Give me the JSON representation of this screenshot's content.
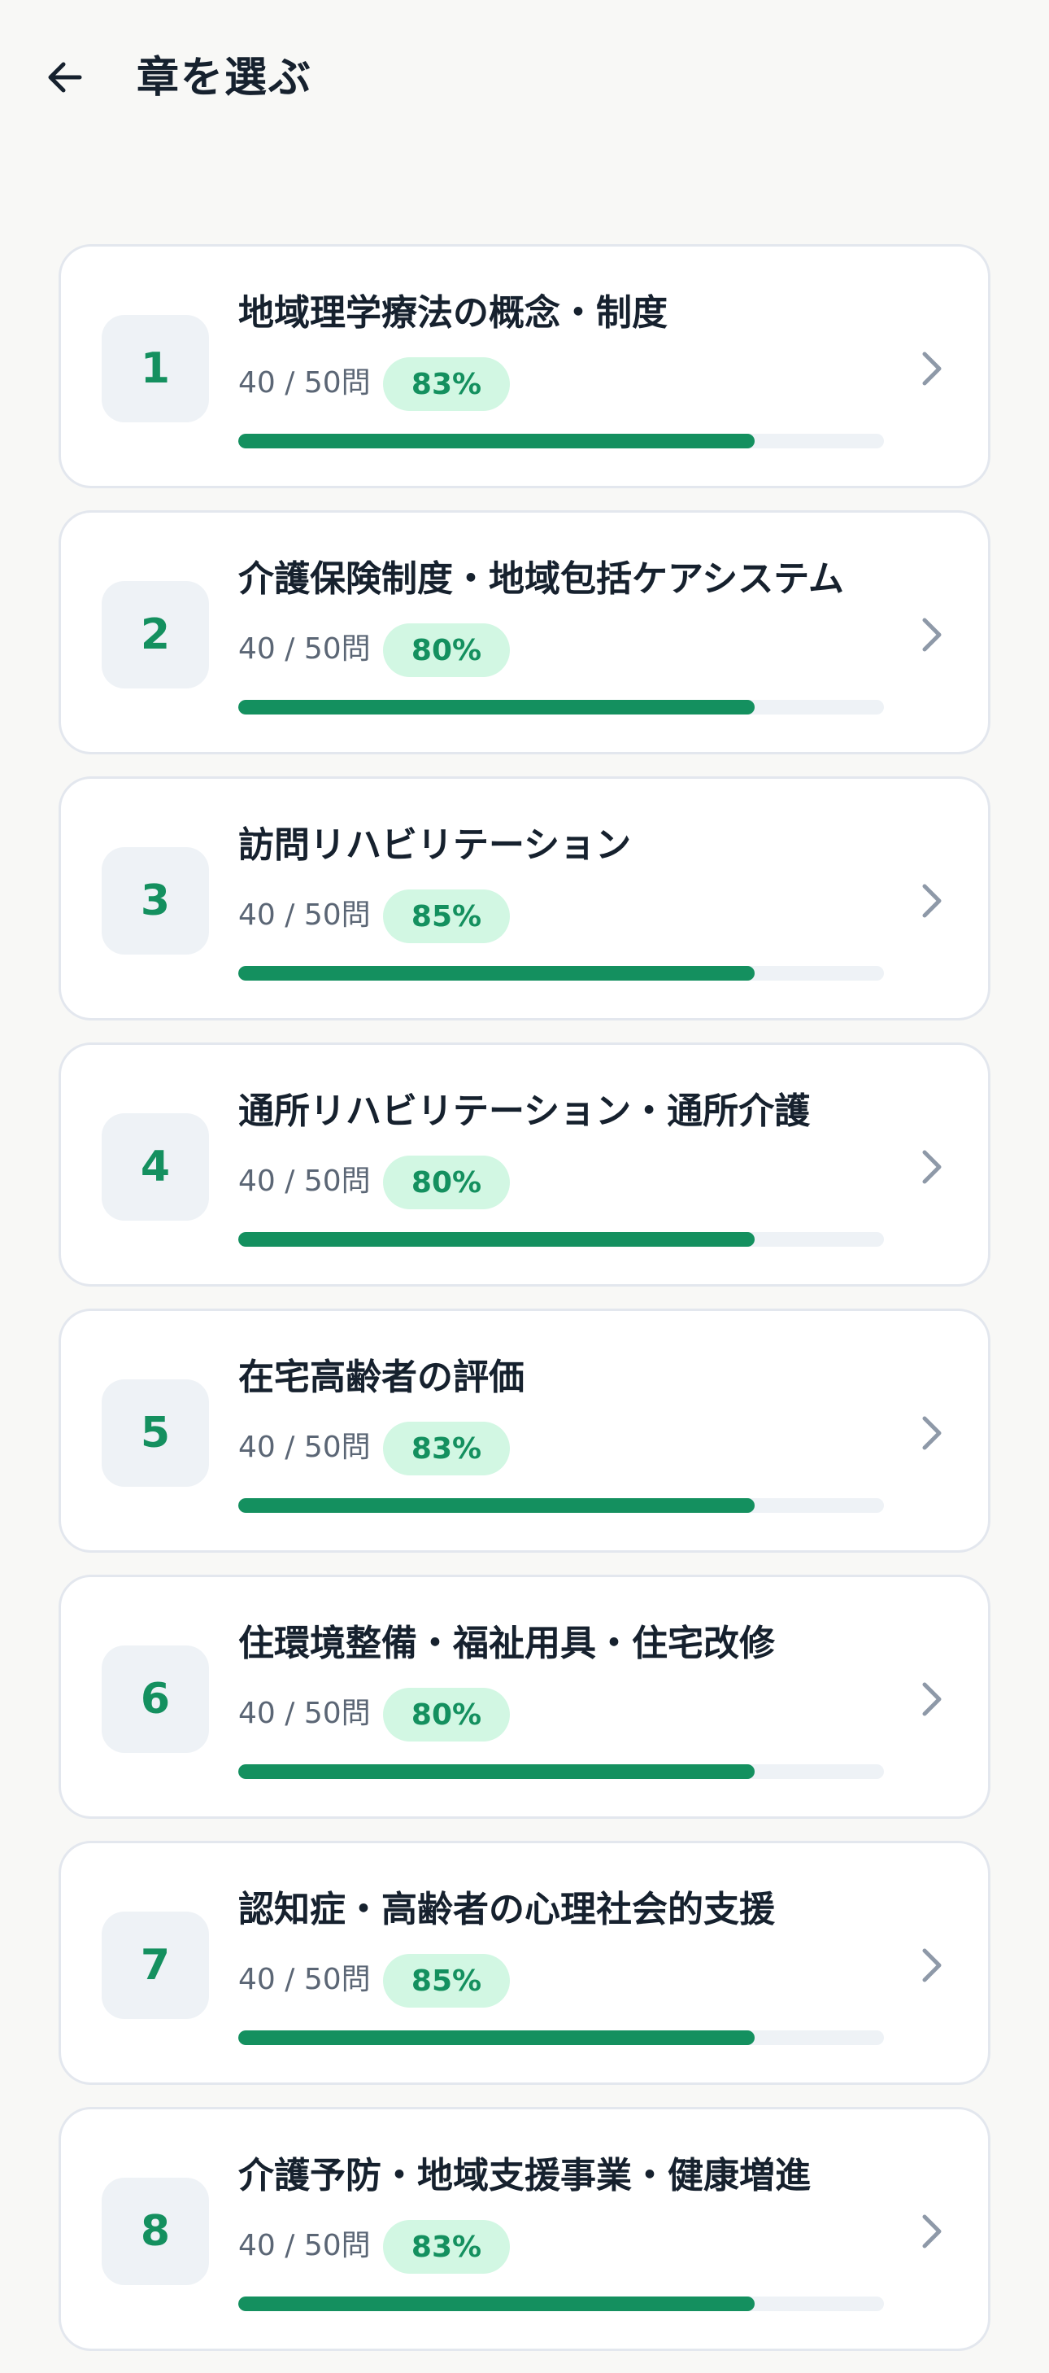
{
  "header": {
    "title": "章を選ぶ",
    "back_icon": "arrow-left-icon"
  },
  "colors": {
    "accent": "#14905f",
    "badge_bg": "#d2f7e3",
    "track": "#eef2f6",
    "card_border": "#e3e7ee",
    "background": "#f8f8f6"
  },
  "chapters": [
    {
      "number": "1",
      "title": "地域理学療法の概念・制度",
      "count": "40 / 50問",
      "percent": "83%",
      "progress": 0.8
    },
    {
      "number": "2",
      "title": "介護保険制度・地域包括ケアシステム",
      "count": "40 / 50問",
      "percent": "80%",
      "progress": 0.8
    },
    {
      "number": "3",
      "title": "訪問リハビリテーション",
      "count": "40 / 50問",
      "percent": "85%",
      "progress": 0.8
    },
    {
      "number": "4",
      "title": "通所リハビリテーション・通所介護",
      "count": "40 / 50問",
      "percent": "80%",
      "progress": 0.8
    },
    {
      "number": "5",
      "title": "在宅高齢者の評価",
      "count": "40 / 50問",
      "percent": "83%",
      "progress": 0.8
    },
    {
      "number": "6",
      "title": "住環境整備・福祉用具・住宅改修",
      "count": "40 / 50問",
      "percent": "80%",
      "progress": 0.8
    },
    {
      "number": "7",
      "title": "認知症・高齢者の心理社会的支援",
      "count": "40 / 50問",
      "percent": "85%",
      "progress": 0.8
    },
    {
      "number": "8",
      "title": "介護予防・地域支援事業・健康増進",
      "count": "40 / 50問",
      "percent": "83%",
      "progress": 0.8
    }
  ]
}
